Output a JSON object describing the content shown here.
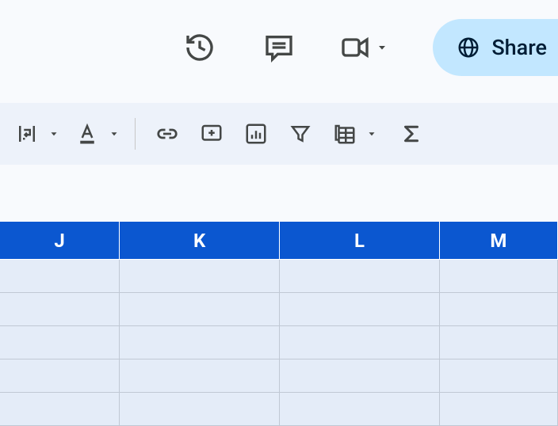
{
  "header": {
    "share_label": "Share"
  },
  "columns": [
    "J",
    "K",
    "L",
    "M"
  ],
  "icons": {
    "history": "history-icon",
    "comments": "comments-icon",
    "meet": "video-icon",
    "share_globe": "globe-icon",
    "wrap": "text-wrap-icon",
    "text_color": "text-color-icon",
    "link": "link-icon",
    "add_comment": "add-comment-icon",
    "chart": "insert-chart-icon",
    "filter": "filter-icon",
    "table": "table-view-icon",
    "functions": "sigma-icon"
  }
}
